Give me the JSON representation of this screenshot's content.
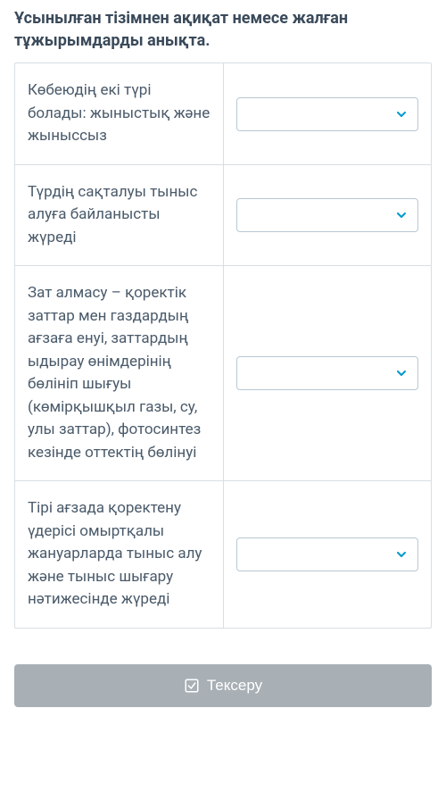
{
  "question": {
    "title": "Ұсынылған тізімнен ақиқат немесе жалған тұжырымдарды анықта."
  },
  "rows": [
    {
      "statement": "Көбеюдің екі түрі болады: жыныстық және жыныссыз"
    },
    {
      "statement": "Түрдің сақталуы тыныс алуға байланысты жүреді"
    },
    {
      "statement": "Зат алмасу – қоректік заттар мен газдардың ағзаға енуі, заттардың ыдырау өнімдерінің бөлініп шығуы (көмірқышқыл газы, су, улы заттар), фотосинтез кезінде оттектің бөлінуі"
    },
    {
      "statement": "Тірі ағзада қоректену үдерісі омыртқалы жануарларда тыныс алу және тыныс шығару нәтижесінде жүреді"
    }
  ],
  "button": {
    "submit_label": "Тексеру"
  }
}
